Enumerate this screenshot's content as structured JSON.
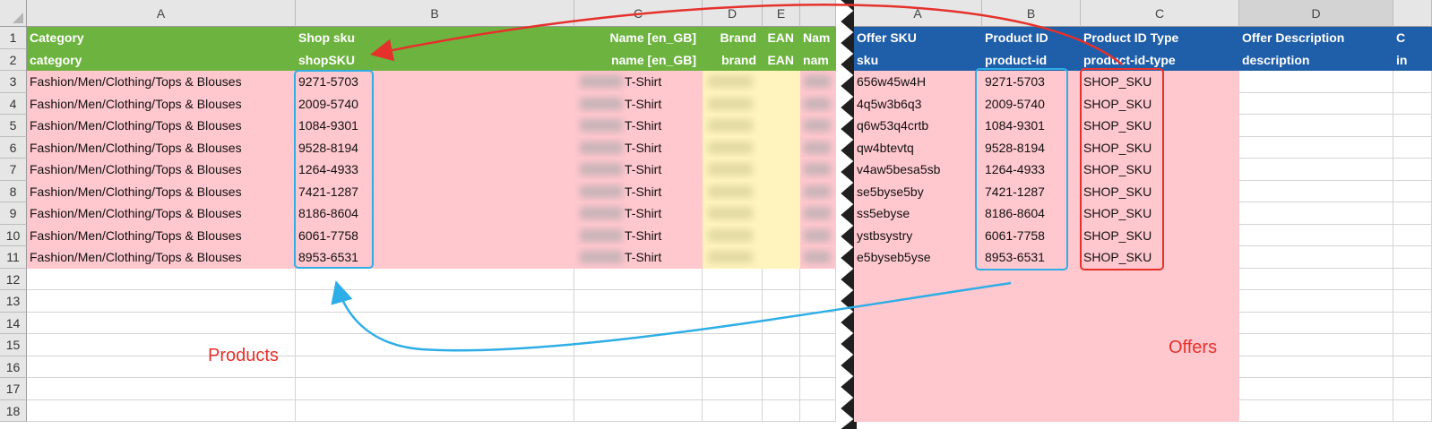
{
  "left_sheet": {
    "columns": [
      "A",
      "B",
      "C",
      "D",
      "E"
    ],
    "header_row_1": [
      "Category",
      "Shop sku",
      "Name [en_GB]",
      "Brand",
      "EAN",
      "Nam"
    ],
    "header_row_2": [
      "category",
      "shopSKU",
      "name [en_GB]",
      "brand",
      "EAN",
      "nam"
    ],
    "category": "Fashion/Men/Clothing/Tops & Blouses",
    "shop_skus": [
      "9271-5703",
      "2009-5740",
      "1084-9301",
      "9528-8194",
      "1264-4933",
      "7421-1287",
      "8186-8604",
      "6061-7758",
      "8953-6531"
    ],
    "name_suffix": "T-Shirt",
    "label": "Products"
  },
  "right_sheet": {
    "columns": [
      "A",
      "B",
      "C",
      "D"
    ],
    "header_row_1": [
      "Offer SKU",
      "Product ID",
      "Product ID Type",
      "Offer Description",
      "C"
    ],
    "header_row_2": [
      "sku",
      "product-id",
      "product-id-type",
      "description",
      "in"
    ],
    "offer_skus": [
      "656w45w4H",
      "4q5w3b6q3",
      "q6w53q4crtb",
      "qw4btevtq",
      "v4aw5besa5sb",
      "se5byse5by",
      "ss5ebyse",
      "ystbsystry",
      "e5byseb5yse"
    ],
    "product_ids": [
      "9271-5703",
      "2009-5740",
      "1084-9301",
      "9528-8194",
      "1264-4933",
      "7421-1287",
      "8186-8604",
      "6061-7758",
      "8953-6531"
    ],
    "product_id_type": "SHOP_SKU",
    "label": "Offers"
  },
  "row_numbers": [
    "1",
    "2",
    "3",
    "4",
    "5",
    "6",
    "7",
    "8",
    "9",
    "10",
    "11",
    "12",
    "13",
    "14",
    "15",
    "16",
    "17",
    "18"
  ],
  "colors": {
    "products_header": "#6db33f",
    "offers_header": "#1f5ea8",
    "data_fill": "#ffc7ce",
    "brand_fill": "#fff4bd",
    "red_annotation": "#e5312b",
    "blue_annotation": "#2eaee6"
  }
}
